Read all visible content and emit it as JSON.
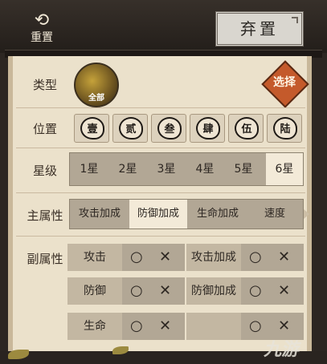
{
  "topbar": {
    "reset_label": "重置",
    "discard_label": "弃置"
  },
  "type_row": {
    "label": "类型",
    "type_value": "全部",
    "choose_label": "选择"
  },
  "position_row": {
    "label": "位置",
    "items": [
      "壹",
      "贰",
      "叁",
      "肆",
      "伍",
      "陆"
    ]
  },
  "star_row": {
    "label": "星级",
    "options": [
      "1星",
      "2星",
      "3星",
      "4星",
      "5星",
      "6星"
    ],
    "selected": "6星"
  },
  "main_attr": {
    "label": "主属性",
    "options": [
      "攻击加成",
      "防御加成",
      "生命加成",
      "速度"
    ],
    "selected": "防御加成"
  },
  "sub_attr": {
    "label": "副属性",
    "items": [
      {
        "name": "攻击",
        "o": "○",
        "x": "✕"
      },
      {
        "name": "攻击加成",
        "o": "○",
        "x": "✕"
      },
      {
        "name": "防御",
        "o": "○",
        "x": "✕"
      },
      {
        "name": "防御加成",
        "o": "○",
        "x": "✕"
      },
      {
        "name": "生命",
        "o": "○",
        "x": "✕"
      },
      {
        "name": "",
        "o": "○",
        "x": "✕"
      }
    ]
  },
  "watermark": "九游",
  "colors": {
    "panel": "#ebe1cb",
    "accent": "#c45a2b",
    "selected": "#f3ead8"
  }
}
